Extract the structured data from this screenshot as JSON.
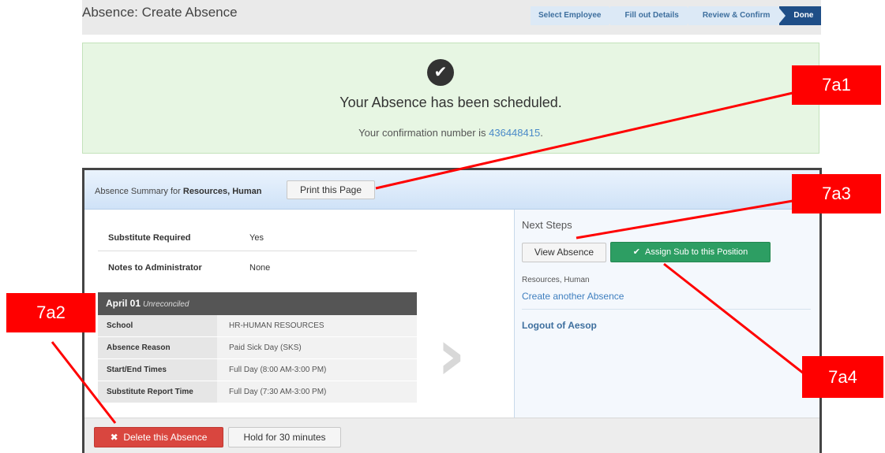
{
  "header": {
    "title": "Absence: Create Absence",
    "steps": [
      "Select Employee",
      "Fill out Details",
      "Review & Confirm",
      "Done"
    ]
  },
  "success": {
    "title": "Your Absence has been scheduled.",
    "confirm_prefix": "Your confirmation number is ",
    "confirm_number": "436448415",
    "confirm_suffix": "."
  },
  "summary": {
    "label": "Absence Summary for ",
    "employee_name": "Resources, Human",
    "print_label": "Print this Page",
    "details": [
      {
        "key": "Substitute Required",
        "value": "Yes"
      },
      {
        "key": "Notes to Administrator",
        "value": "None"
      }
    ],
    "day": {
      "date": "April 01",
      "status": "Unreconciled",
      "rows": [
        {
          "key": "School",
          "value": "HR-HUMAN RESOURCES"
        },
        {
          "key": "Absence Reason",
          "value": "Paid Sick Day (SKS)"
        },
        {
          "key": "Start/End Times",
          "value": "Full Day (8:00 AM-3:00 PM)"
        },
        {
          "key": "Substitute Report Time",
          "value": "Full Day (7:30 AM-3:00 PM)"
        }
      ]
    }
  },
  "next_steps": {
    "title": "Next Steps",
    "view_label": "View Absence",
    "assign_label": "Assign Sub to this Position",
    "name": "Resources, Human",
    "create_label": "Create another Absence",
    "logout_label": "Logout of Aesop"
  },
  "footer": {
    "delete_label": "Delete this Absence",
    "hold_label": "Hold for 30 minutes"
  },
  "callouts": {
    "c1": "7a1",
    "c2": "7a2",
    "c3": "7a3",
    "c4": "7a4"
  },
  "colors": {
    "success_bg": "#e7f6e3",
    "assign_button": "#2d9e63",
    "delete_button": "#d9463f",
    "callout": "#ff0000",
    "step_active": "#1f4e87"
  },
  "icons": {
    "success": "check-circle-icon",
    "assign": "check-icon",
    "delete": "close-icon",
    "divider": "chevron-right-icon"
  }
}
